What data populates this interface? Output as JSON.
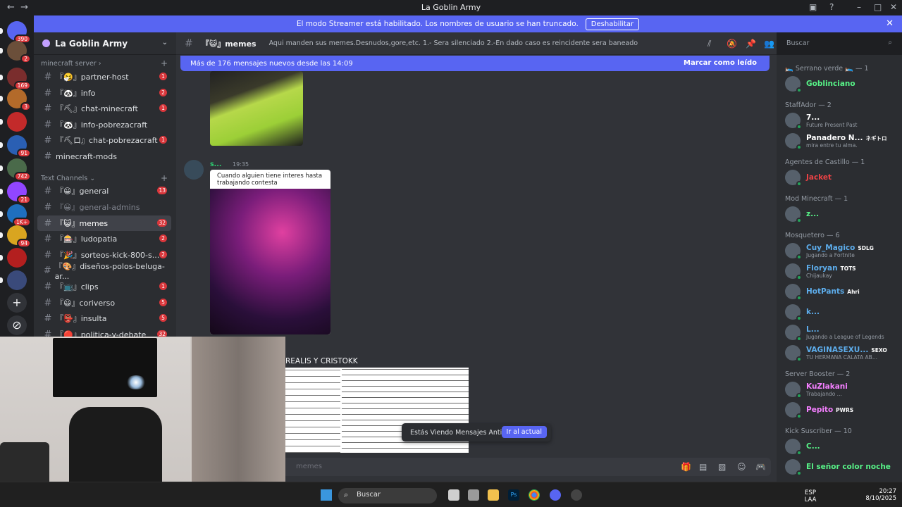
{
  "window": {
    "title": "La Goblin Army"
  },
  "streamer_banner": {
    "text": "El modo Streamer está habilitado. Los nombres de usuario se han truncado.",
    "button": "Deshabilitar"
  },
  "servers": [
    {
      "badge": "390",
      "color": "#5865f2"
    },
    {
      "badge": "2",
      "color": "#6b4f3a"
    },
    {
      "badge": "169",
      "color": "#7a2d2d"
    },
    {
      "badge": "3",
      "color": "#b36a2a"
    },
    {
      "badge": "",
      "color": "#c32a2a"
    },
    {
      "badge": "91",
      "color": "#2a5fb3"
    },
    {
      "badge": "742",
      "color": "#4a6a4a"
    },
    {
      "badge": "21",
      "color": "#9146ff"
    },
    {
      "badge": "1K+",
      "color": "#1f6fbf"
    },
    {
      "badge": "94",
      "color": "#d9a520"
    },
    {
      "badge": "",
      "color": "#b31f1f"
    },
    {
      "badge": "",
      "color": "#3a4a7a"
    }
  ],
  "guild": {
    "name": "La Goblin Army"
  },
  "categories": {
    "minecraft": "minecraft server",
    "text": "Text Channels"
  },
  "channels": [
    {
      "label": "『🤧』partner-host",
      "badge": "1"
    },
    {
      "label": "『🐼』info",
      "badge": "2"
    },
    {
      "label": "『⛏』chat-minecraft",
      "badge": "1"
    },
    {
      "label": "『🐼』info-pobrezacraft",
      "badge": ""
    },
    {
      "label": "『⛏ロ』chat-pobrezacraft",
      "badge": "1"
    },
    {
      "label": "minecraft-mods",
      "badge": ""
    },
    {
      "label": "『😀』general",
      "badge": "13"
    },
    {
      "label": "『😀』general-admins",
      "badge": ""
    },
    {
      "label": "『😺』memes",
      "badge": "32"
    },
    {
      "label": "『🎰』ludopatia",
      "badge": "2"
    },
    {
      "label": "『🎉』sorteos-kick-800-s...",
      "badge": "2"
    },
    {
      "label": "『🎨』diseños-polos-beluga-ar...",
      "badge": ""
    },
    {
      "label": "『📺』clips",
      "badge": "1"
    },
    {
      "label": "『😃』coriverso",
      "badge": "5"
    },
    {
      "label": "『👺』insulta",
      "badge": "5"
    },
    {
      "label": "『🔴』politica-y-debate",
      "badge": "32"
    }
  ],
  "channel_header": {
    "name": "『😺』memes",
    "topic": "Aqui manden sus memes.Desnudos,gore,etc. 1.- Sera silenciado 2.-En dado caso es reincidente sera baneado"
  },
  "search": {
    "placeholder": "Buscar"
  },
  "new_messages": {
    "text": "Más de 176 mensajes nuevos desde las 14:09",
    "mark": "Marcar como leído"
  },
  "message": {
    "author": "s...",
    "time": "19:35",
    "caption": "Cuando alguien tiene interes hasta trabajando contesta"
  },
  "message2": {
    "text": "REALIS Y CRISTOKK"
  },
  "toast": {
    "text": "Estás Viendo Mensajes Antiguos",
    "button": "Ir al actual"
  },
  "composer": {
    "placeholder": "Enviar mensaje a #『😺』memes",
    "visible": "memes"
  },
  "member_groups": [
    {
      "title": "🛌 Serrano verde 🛌 — 1",
      "members": [
        {
          "name": "Goblinciano",
          "color": "#57f287",
          "sub": "",
          "tag": ""
        }
      ]
    },
    {
      "title": "StaffAdor — 2",
      "members": [
        {
          "name": "7...",
          "color": "#ffffff",
          "sub": "Future Present Past",
          "tag": ""
        },
        {
          "name": "Panadero N...",
          "color": "#ffffff",
          "sub": "mira entre tu alma.",
          "tag": "ネギトロ"
        }
      ]
    },
    {
      "title": "Agentes de Castillo — 1",
      "members": [
        {
          "name": "Jacket",
          "color": "#ed4245",
          "sub": "",
          "tag": ""
        }
      ]
    },
    {
      "title": "Mod Minecraft — 1",
      "members": [
        {
          "name": "z...",
          "color": "#57f287",
          "sub": "",
          "tag": ""
        }
      ]
    },
    {
      "title": "Mosquetero — 6",
      "members": [
        {
          "name": "Cuy_Magico",
          "color": "#5dadec",
          "sub": "Jugando a Fortnite",
          "tag": "SDLG"
        },
        {
          "name": "Floryan",
          "color": "#5dadec",
          "sub": "Chijaukay",
          "tag": "TOTS"
        },
        {
          "name": "HotPants",
          "color": "#5dadec",
          "sub": "",
          "tag": "Ahri"
        },
        {
          "name": "k...",
          "color": "#5dadec",
          "sub": "",
          "tag": ""
        },
        {
          "name": "L...",
          "color": "#5dadec",
          "sub": "Jugando a League of Legends",
          "tag": ""
        },
        {
          "name": "VAGINASEXU...",
          "color": "#5dadec",
          "sub": "TU HERMANA CALATA AB...",
          "tag": "SEXO"
        }
      ]
    },
    {
      "title": "Server Booster — 2",
      "members": [
        {
          "name": "KuZlakani",
          "color": "#f47fff",
          "sub": "Trabajando ...",
          "tag": ""
        },
        {
          "name": "Pepito",
          "color": "#f47fff",
          "sub": "",
          "tag": "PWRS"
        }
      ]
    },
    {
      "title": "Kick Suscriber — 10",
      "members": [
        {
          "name": "C...",
          "color": "#57f287",
          "sub": "",
          "tag": ""
        },
        {
          "name": "El señor color noche",
          "color": "#57f287",
          "sub": "",
          "tag": ""
        }
      ]
    }
  ],
  "taskbar": {
    "search": "Buscar",
    "lang1": "ESP",
    "lang2": "LAA",
    "time": "20:27",
    "date": "8/10/2025"
  }
}
